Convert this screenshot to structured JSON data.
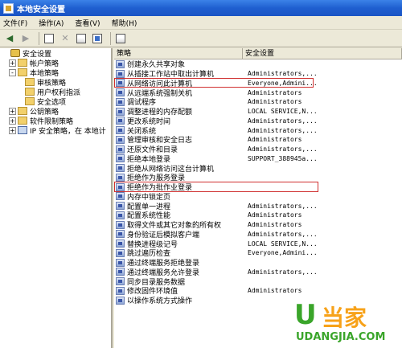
{
  "window": {
    "title": "本地安全设置"
  },
  "menu": [
    "文件(F)",
    "操作(A)",
    "查看(V)",
    "帮助(H)"
  ],
  "toolbar": {
    "icons": [
      "back-arrow-icon",
      "forward-arrow-icon",
      "up-folder-icon",
      "delete-icon",
      "properties-icon",
      "export-list-icon",
      "help-icon"
    ]
  },
  "tree": [
    {
      "label": "安全设置",
      "level": 0,
      "icon": "lock",
      "exp": ""
    },
    {
      "label": "帐户策略",
      "level": 1,
      "icon": "folder",
      "exp": "+"
    },
    {
      "label": "本地策略",
      "level": 1,
      "icon": "folder",
      "exp": "-"
    },
    {
      "label": "审核策略",
      "level": 2,
      "icon": "folder",
      "exp": ""
    },
    {
      "label": "用户权利指派",
      "level": 2,
      "icon": "folder",
      "exp": ""
    },
    {
      "label": "安全选项",
      "level": 2,
      "icon": "folder",
      "exp": ""
    },
    {
      "label": "公钥策略",
      "level": 1,
      "icon": "folder",
      "exp": "+"
    },
    {
      "label": "软件限制策略",
      "level": 1,
      "icon": "folder",
      "exp": "+"
    },
    {
      "label": "IP 安全策略，在 本地计",
      "level": 1,
      "icon": "pc",
      "exp": "+"
    }
  ],
  "list": {
    "headers": [
      "策略",
      "安全设置"
    ],
    "rows": [
      {
        "name": "创建永久共享对象",
        "value": ""
      },
      {
        "name": "从插接工作站中取出计算机",
        "value": "Administrators,..."
      },
      {
        "name": "从网络访问此计算机",
        "value": "Everyone,Admini..."
      },
      {
        "name": "从远端系统强制关机",
        "value": "Administrators"
      },
      {
        "name": "调试程序",
        "value": "Administrators"
      },
      {
        "name": "调整进程的内存配额",
        "value": "LOCAL SERVICE,N..."
      },
      {
        "name": "更改系统时间",
        "value": "Administrators,..."
      },
      {
        "name": "关闭系统",
        "value": "Administrators,..."
      },
      {
        "name": "管理审核和安全日志",
        "value": "Administrators"
      },
      {
        "name": "还原文件和目录",
        "value": "Administrators,..."
      },
      {
        "name": "拒绝本地登录",
        "value": "SUPPORT_388945a..."
      },
      {
        "name": "拒绝从网络访问这台计算机",
        "value": ""
      },
      {
        "name": "拒绝作为服务登录",
        "value": ""
      },
      {
        "name": "拒绝作为批作业登录",
        "value": ""
      },
      {
        "name": "内存中锁定页",
        "value": ""
      },
      {
        "name": "配置单一进程",
        "value": "Administrators,..."
      },
      {
        "name": "配置系统性能",
        "value": "Administrators"
      },
      {
        "name": "取得文件或其它对象的所有权",
        "value": "Administrators"
      },
      {
        "name": "身份验证后模拟客户端",
        "value": "Administrators,..."
      },
      {
        "name": "替换进程级记号",
        "value": "LOCAL SERVICE,N..."
      },
      {
        "name": "跳过遍历检查",
        "value": "Everyone,Admini..."
      },
      {
        "name": "通过终端服务拒绝登录",
        "value": ""
      },
      {
        "name": "通过终端服务允许登录",
        "value": "Administrators,..."
      },
      {
        "name": "同步目录服务数据",
        "value": ""
      },
      {
        "name": "修改固件环境值",
        "value": "Administrators"
      },
      {
        "name": "以操作系统方式操作",
        "value": ""
      }
    ]
  },
  "watermark": {
    "u": "U",
    "cn": "当家",
    "url": "UDANGJIA.COM"
  },
  "colors": {
    "titlebar": "#1f5fd0",
    "highlight": "#d03030",
    "watermark_green": "#3aa52a",
    "watermark_orange": "#f7a21a"
  }
}
